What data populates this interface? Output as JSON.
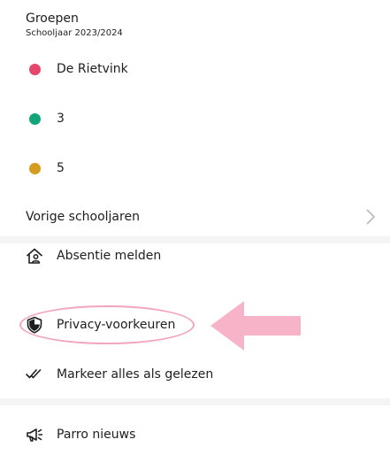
{
  "groups": {
    "title": "Groepen",
    "subtitle": "Schooljaar 2023/2024",
    "items": [
      {
        "label": "De Rietvink",
        "color": "#e5476b"
      },
      {
        "label": "3",
        "color": "#12a57a"
      },
      {
        "label": "5",
        "color": "#d59c1e"
      }
    ]
  },
  "previous_years": {
    "label": "Vorige schooljaren",
    "icon": "chevron-right-icon"
  },
  "menu": {
    "absence": {
      "label": "Absentie melden",
      "icon": "home-person-icon"
    },
    "privacy": {
      "label": "Privacy-voorkeuren",
      "icon": "shield-icon"
    },
    "mark_read": {
      "label": "Markeer alles als gelezen",
      "icon": "double-check-icon"
    },
    "news": {
      "label": "Parro nieuws",
      "icon": "megaphone-icon"
    }
  },
  "annotation": {
    "highlight_color": "#f3a5bd",
    "arrow_color": "#f7b3c8"
  }
}
